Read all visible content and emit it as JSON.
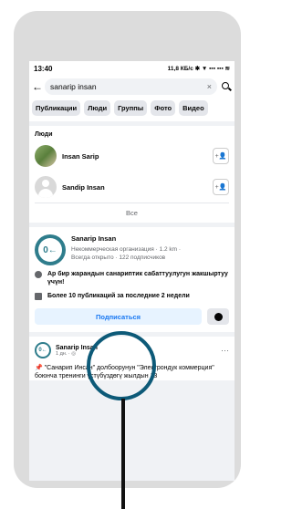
{
  "status": {
    "time": "13:40",
    "right": "11,8 КБ/с ✱ ▼ ▪▪▪ ▪▪▪ ≋"
  },
  "search": {
    "value": "sanarip insan",
    "clear": "×"
  },
  "tabs": [
    "Публикации",
    "Люди",
    "Группы",
    "Фото",
    "Видео"
  ],
  "people": {
    "title": "Люди",
    "items": [
      {
        "name": "Insan Sarip"
      },
      {
        "name": "Sandip Insan"
      }
    ],
    "all_label": "Все"
  },
  "page": {
    "name": "Sanarip Insan",
    "logo": "0←",
    "info": "Некоммерческая организация · 1.2 km ·",
    "info2": "Всегда открыто · 122 подписчиков",
    "fact1": "Ар бир жарандын санариптик сабаттуулугун жакшыртуу үчүн!",
    "fact2": "Более 10 публикаций за последние 2 недели",
    "subscribe": "Подписаться"
  },
  "post": {
    "name": "Sanarip Insan",
    "time": "1 дн. · ◎",
    "text": "📌 \"Санарип Инсан\" долбоорунун \"Электрондук коммерция\" боюнча тренинги үстүбүздөгү жылдын 13"
  },
  "colors": {
    "accent": "#1877f2",
    "highlight": "#0d5a78",
    "brand": "#2f7d8c"
  }
}
